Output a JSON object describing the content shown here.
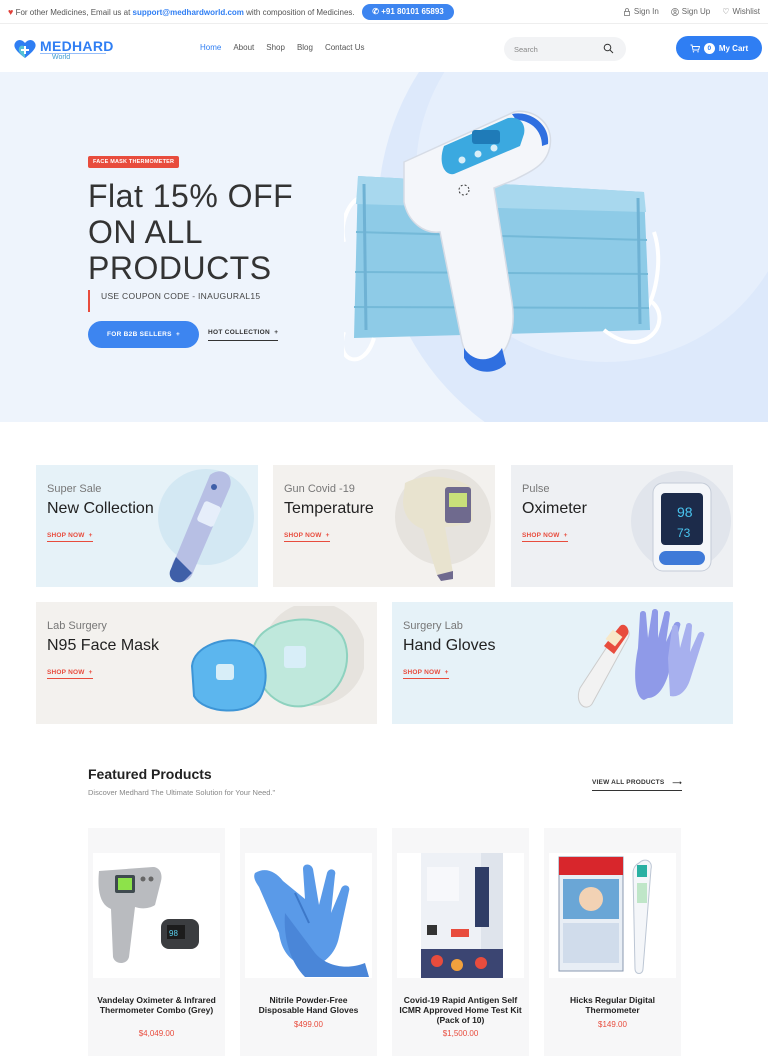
{
  "topbar": {
    "info_prefix": "For other Medicines, Email us at",
    "email": "support@medhardworld.com",
    "info_suffix": "with composition of Medicines.",
    "phone": "+91 80101 65893",
    "sign_in": "Sign In",
    "sign_up": "Sign Up",
    "wishlist": "Wishlist"
  },
  "header": {
    "logo_name": "MEDHARD",
    "logo_sub": "World",
    "nav": [
      "Home",
      "About",
      "Shop",
      "Blog",
      "Contact Us"
    ],
    "search_placeholder": "Search",
    "cart_count": "0",
    "cart_label": "My Cart"
  },
  "hero": {
    "badge": "FACE MASK THERMOMETER",
    "title_line1": "Flat 15% OFF",
    "title_line2": "ON ALL",
    "title_line3": "PRODUCTS",
    "coupon": "USE COUPON CODE - INAUGURAL15",
    "b2b_button": "FOR B2B SELLERS",
    "hot_collection": "HOT COLLECTION"
  },
  "categories": [
    {
      "sub": "Super Sale",
      "title": "New Collection",
      "cta": "SHOP NOW",
      "color": "#e6f2f8"
    },
    {
      "sub": "Gun Covid -19",
      "title": "Temperature",
      "cta": "SHOP NOW",
      "color": "#f3f1ee"
    },
    {
      "sub": "Pulse",
      "title": "Oximeter",
      "cta": "SHOP NOW",
      "color": "#eef0f3"
    },
    {
      "sub": "Lab Surgery",
      "title": "N95 Face Mask",
      "cta": "SHOP NOW",
      "color": "#f3f1ee"
    },
    {
      "sub": "Surgery Lab",
      "title": "Hand Gloves",
      "cta": "SHOP NOW",
      "color": "#e6f2f8"
    }
  ],
  "featured": {
    "title": "Featured Products",
    "subtitle": "Discover Medhard The Ultimate Solution for Your Need.\"",
    "view_all": "VIEW ALL PRODUCTS",
    "products": [
      {
        "name": "Vandelay Oximeter & Infrared Thermometer Combo (Grey)",
        "price": "$4,049.00"
      },
      {
        "name": "Nitrile Powder-Free Disposable Hand Gloves",
        "price": "$499.00"
      },
      {
        "name": "Covid-19 Rapid Antigen Self ICMR Approved Home Test Kit (Pack of 10)",
        "price": "$1,500.00"
      },
      {
        "name": "Hicks Regular Digital Thermometer",
        "price": "$149.00"
      }
    ]
  },
  "colors": {
    "brand": "#2f7ef3",
    "accent": "#e84c3d"
  },
  "icons": [
    "heart-icon",
    "phone-icon",
    "lock-icon",
    "user-icon",
    "heart-outline-icon",
    "search-icon",
    "cart-icon",
    "plus-icon",
    "arrow-right-icon"
  ]
}
